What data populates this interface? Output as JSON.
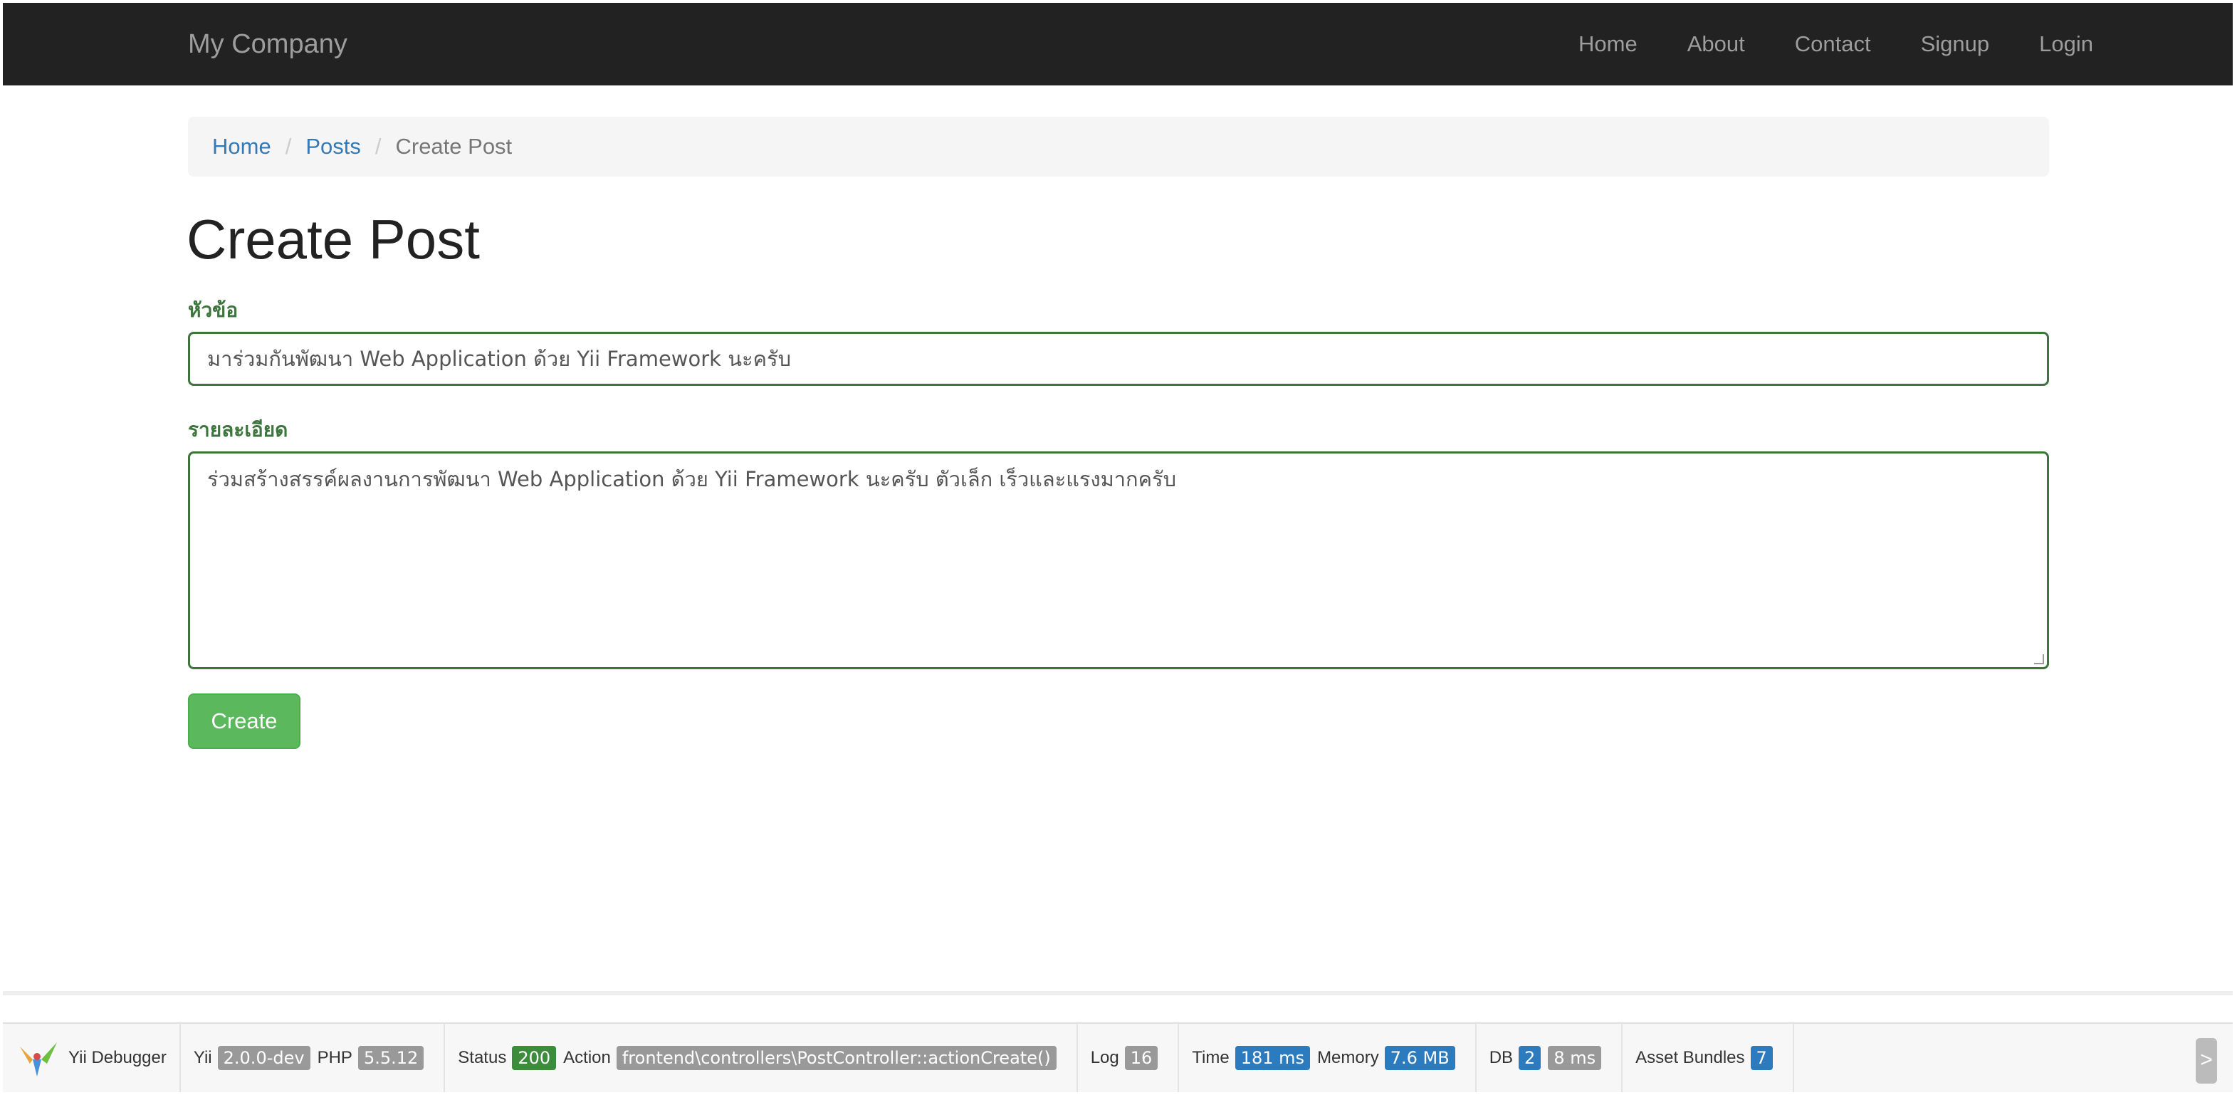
{
  "navbar": {
    "brand": "My Company",
    "links": [
      "Home",
      "About",
      "Contact",
      "Signup",
      "Login"
    ]
  },
  "breadcrumb": {
    "items": [
      "Home",
      "Posts"
    ],
    "active": "Create Post",
    "separator": "/"
  },
  "page": {
    "title": "Create Post"
  },
  "form": {
    "title_label": "หัวข้อ",
    "title_value": "มาร่วมกันพัฒนา Web Application ด้วย Yii Framework นะครับ",
    "content_label": "รายละเอียด",
    "content_value": "ร่วมสร้างสรรค์ผลงานการพัฒนา Web Application ด้วย Yii Framework นะครับ ตัวเล็ก เร็วและแรงมากครับ",
    "submit_label": "Create"
  },
  "debugbar": {
    "name": "Yii Debugger",
    "yii_label": "Yii",
    "yii_version": "2.0.0-dev",
    "php_label": "PHP",
    "php_version": "5.5.12",
    "status_label": "Status",
    "status_code": "200",
    "action_label": "Action",
    "action_value": "frontend\\controllers\\PostController::actionCreate()",
    "log_label": "Log",
    "log_count": "16",
    "time_label": "Time",
    "time_value": "181 ms",
    "memory_label": "Memory",
    "memory_value": "7.6 MB",
    "db_label": "DB",
    "db_count": "2",
    "db_time": "8 ms",
    "assets_label": "Asset Bundles",
    "assets_count": "7",
    "toggle_glyph": ">"
  },
  "colors": {
    "navbar_bg": "#222222",
    "nav_text": "#9d9d9d",
    "link": "#337ab7",
    "success": "#3c763d",
    "button": "#5cb85c"
  },
  "icons": [
    "yii-logo-icon",
    "chevron-right-icon"
  ]
}
